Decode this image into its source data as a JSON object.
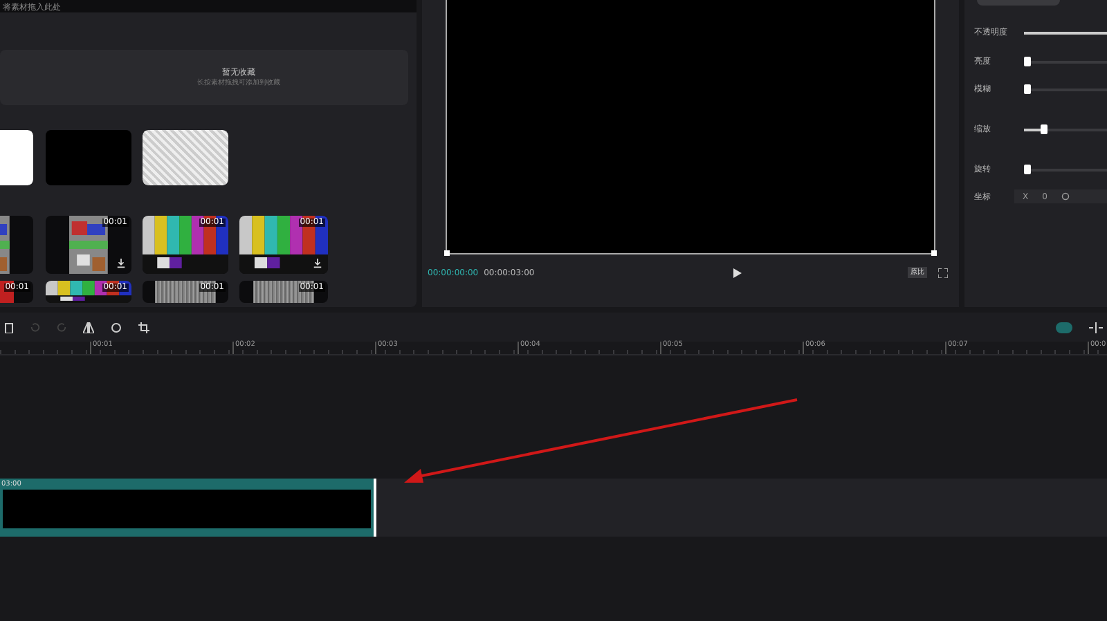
{
  "library": {
    "hint": "将素材拖入此处",
    "empty_title": "暂无收藏",
    "empty_subtitle": "长按素材拖拽可添加到收藏",
    "rows": [
      [
        {
          "kind": "white"
        },
        {
          "kind": "black"
        },
        {
          "kind": "transparent"
        }
      ],
      [
        {
          "kind": "glitch"
        },
        {
          "kind": "glitch",
          "duration": "00:01",
          "downloadable": true
        },
        {
          "kind": "bars",
          "duration": "00:01"
        },
        {
          "kind": "bars",
          "duration": "00:01",
          "downloadable": true
        }
      ],
      [
        {
          "kind": "red",
          "duration": "00:01"
        },
        {
          "kind": "bars",
          "duration": "00:01"
        },
        {
          "kind": "noise",
          "duration": "00:01"
        },
        {
          "kind": "noise",
          "duration": "00:01"
        }
      ]
    ]
  },
  "preview": {
    "current_time": "00:00:00:00",
    "total_time": "00:00:03:00",
    "ratio_button": "原比"
  },
  "properties": {
    "params": [
      {
        "label": "不透明度",
        "level": 1
      },
      {
        "label": "亮度",
        "level": 0
      },
      {
        "label": "模糊",
        "level": 0
      },
      {
        "label": "缩放",
        "level": 0.2
      },
      {
        "label": "旋转",
        "level": 0
      }
    ],
    "position": {
      "label": "坐标",
      "fields": [
        "X",
        "0"
      ]
    }
  },
  "timeline": {
    "ruler": [
      "00:01",
      "00:02",
      "00:03",
      "00:04",
      "00:05",
      "00:06",
      "00:07",
      "00:0"
    ],
    "clip": {
      "label": "03:00",
      "selected": true
    },
    "snap_on": true
  }
}
